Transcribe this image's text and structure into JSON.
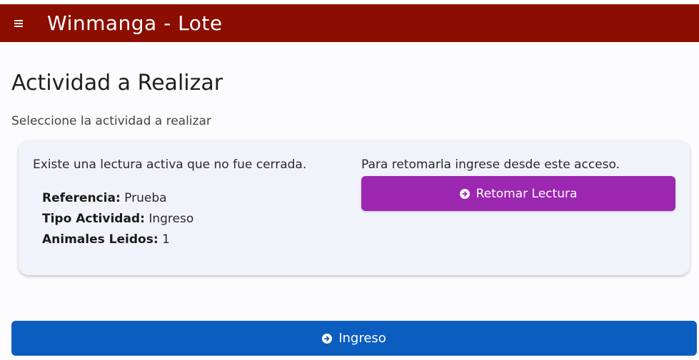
{
  "appbar": {
    "menu_icon": "menu-icon",
    "title": "Winmanga - Lote"
  },
  "page": {
    "title": "Actividad a Realizar",
    "subtitle": "Seleccione la actividad a realizar"
  },
  "active_reading_card": {
    "notice": "Existe una lectura activa que no fue cerrada.",
    "details": [
      {
        "label": "Referencia:",
        "value": "Prueba"
      },
      {
        "label": "Tipo Actividad:",
        "value": "Ingreso"
      },
      {
        "label": "Animales Leidos:",
        "value": "1"
      }
    ],
    "resume_hint": "Para retomarla ingrese desde este acceso.",
    "resume_button": {
      "label": "Retomar Lectura",
      "icon": "arrow-circle-right-icon"
    }
  },
  "ingreso_button": {
    "label": "Ingreso",
    "icon": "arrow-circle-right-icon"
  },
  "colors": {
    "appbar": "#8b0e00",
    "resume_button": "#9c27b0",
    "ingreso_button": "#0b5dc0",
    "card_bg": "#f1f3fb"
  }
}
